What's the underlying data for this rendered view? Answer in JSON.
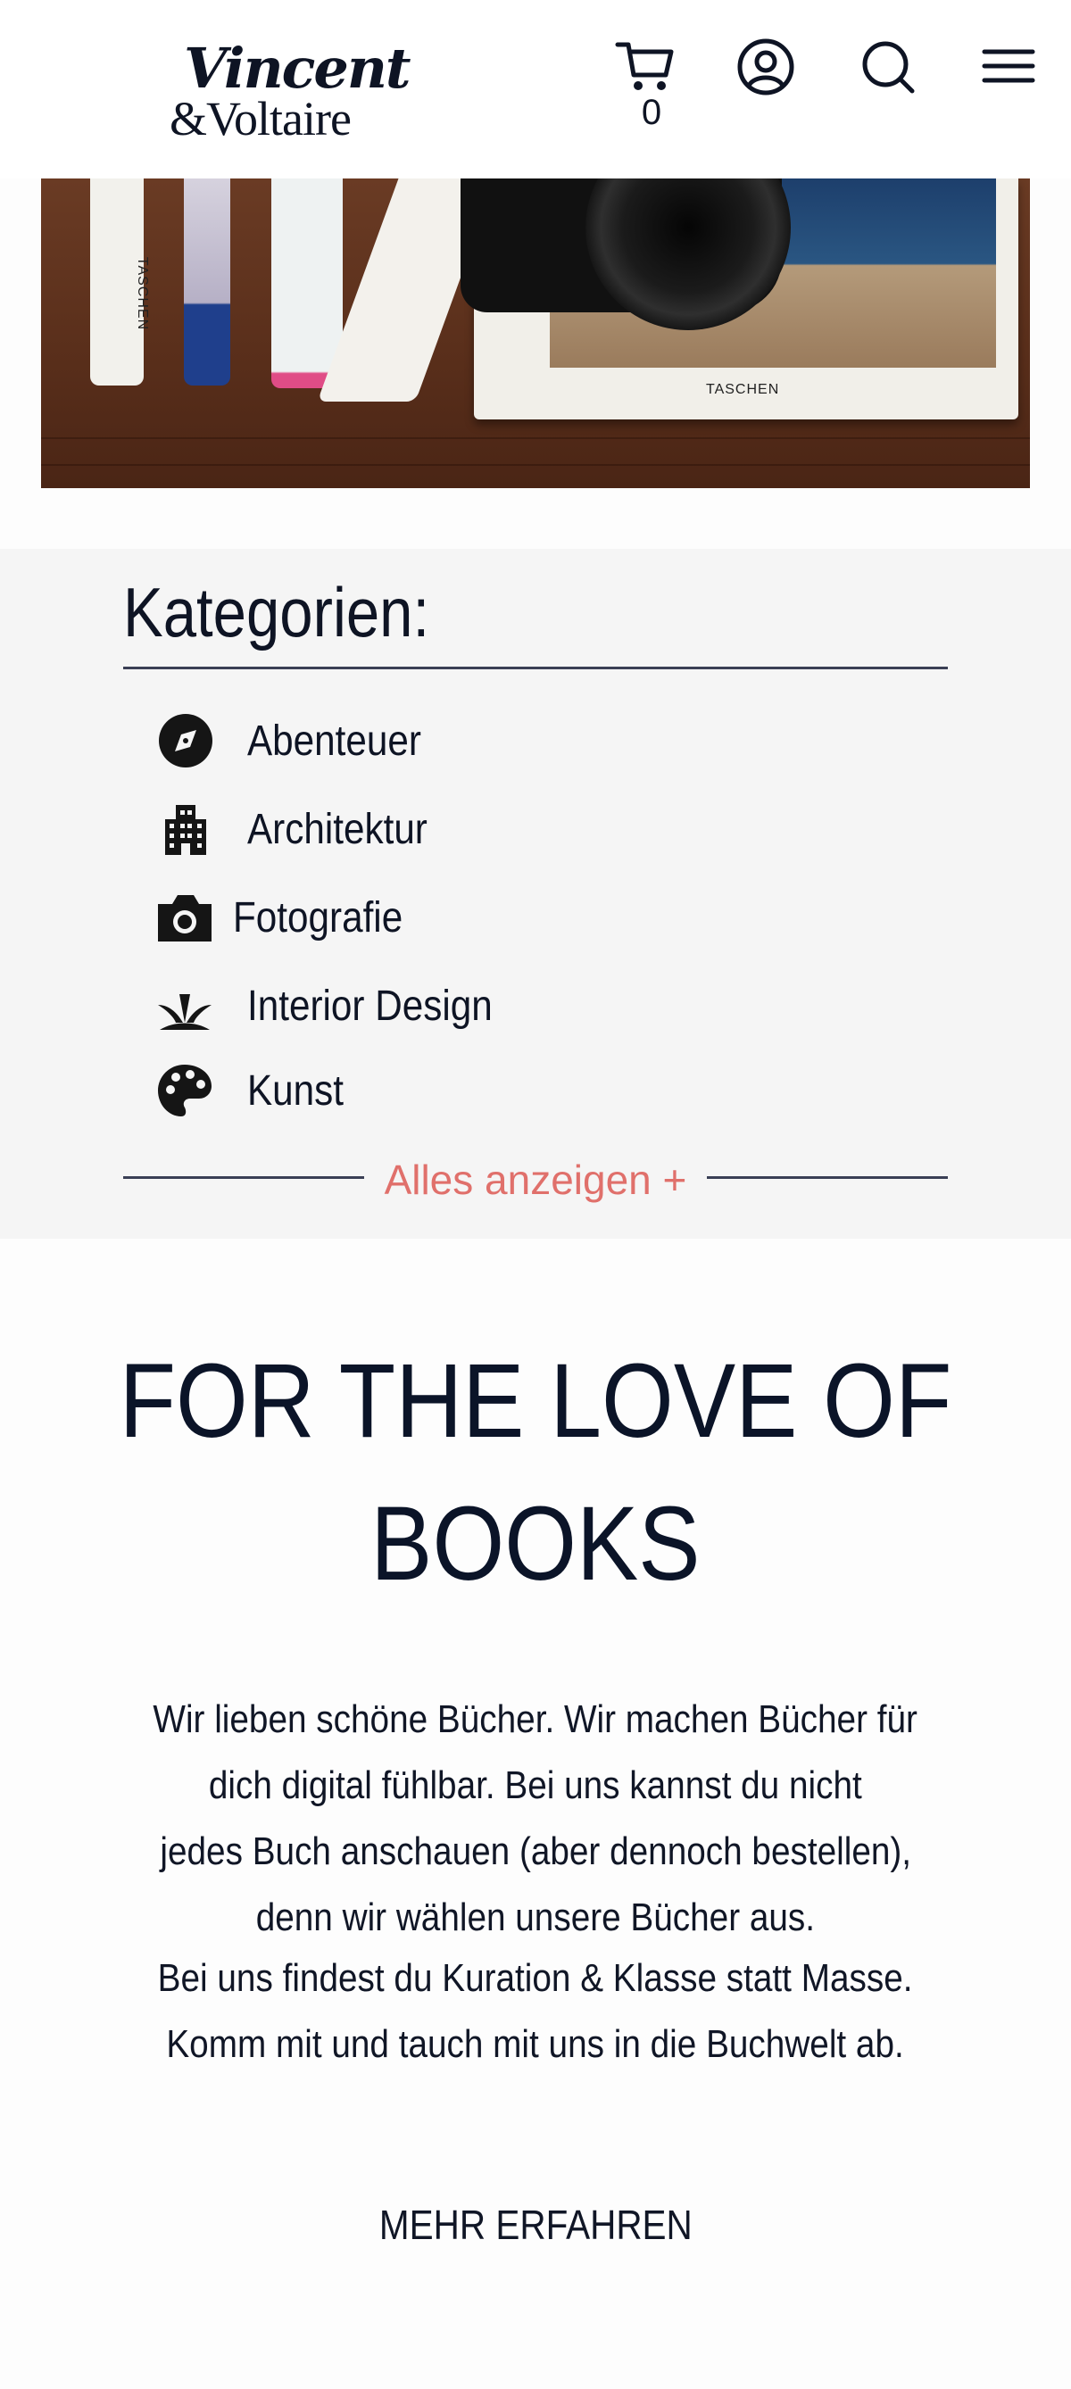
{
  "header": {
    "logo_line1": "Vincent",
    "logo_line2": "&Voltaire",
    "cart_count": "0",
    "icons": [
      "cart-icon",
      "account-icon",
      "search-icon",
      "menu-icon"
    ]
  },
  "hero_image": {
    "spine_text": "TASCHEN",
    "book_text": "TASCHEN"
  },
  "categories": {
    "title": "Kategorien:",
    "items": [
      {
        "label": "Abenteuer",
        "icon": "compass-icon"
      },
      {
        "label": "Architektur",
        "icon": "building-icon"
      },
      {
        "label": "Fotografie",
        "icon": "camera-icon"
      },
      {
        "label": "Interior Design",
        "icon": "plant-icon"
      },
      {
        "label": "Kunst",
        "icon": "palette-icon"
      }
    ],
    "show_all": "Alles anzeigen +"
  },
  "intro": {
    "heading_line1": "FOR THE LOVE OF",
    "heading_line2": "BOOKS",
    "text_lines": [
      "Wir lieben schöne Bücher. Wir machen Bücher für",
      "dich digital fühlbar. Bei uns kannst du nicht",
      "jedes Buch anschauen (aber dennoch bestellen),",
      "denn wir wählen unsere Bücher aus.",
      "Bei uns findest du Kuration & Klasse statt Masse.",
      "Komm mit und tauch mit uns in die Buchwelt ab."
    ],
    "more_label": "MEHR ERFAHREN"
  },
  "colors": {
    "accent": "#e0706b",
    "text": "#0e1424",
    "category_bg": "#f5f5f5"
  }
}
